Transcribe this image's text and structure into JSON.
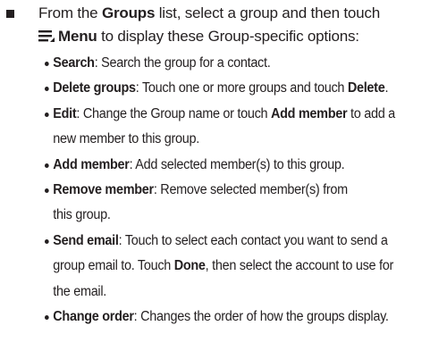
{
  "intro": {
    "part1": "From the ",
    "groups": "Groups",
    "part2": " list, select a group and then touch",
    "menu_icon": "menu-icon",
    "menu": "Menu",
    "part3": " to display these Group-specific options:"
  },
  "options": [
    {
      "term": "Search",
      "lines": [
        ": Search the group for a contact."
      ]
    },
    {
      "term": "Delete groups",
      "lines": [
        ": Touch one or more groups and touch "
      ],
      "tail_bold": "Delete",
      "tail_end": "."
    },
    {
      "term": "Edit",
      "line1a": ": Change the Group name or touch ",
      "line1b": "Add member",
      "line1c": " to add a",
      "line2": "new member to this group."
    },
    {
      "term": "Add member",
      "lines": [
        ": Add selected member(s) to this group."
      ]
    },
    {
      "term": "Remove member",
      "line1": ": Remove selected member(s) from",
      "line2": "this group."
    },
    {
      "term": "Send email",
      "line1": ": Touch to select each contact you want to send a",
      "line2a": "group email to. Touch ",
      "line2b": "Done",
      "line2c": ", then select the account to use for",
      "line3": "the email."
    },
    {
      "term": "Change order",
      "lines": [
        ": Changes the order of how the groups display."
      ]
    }
  ]
}
